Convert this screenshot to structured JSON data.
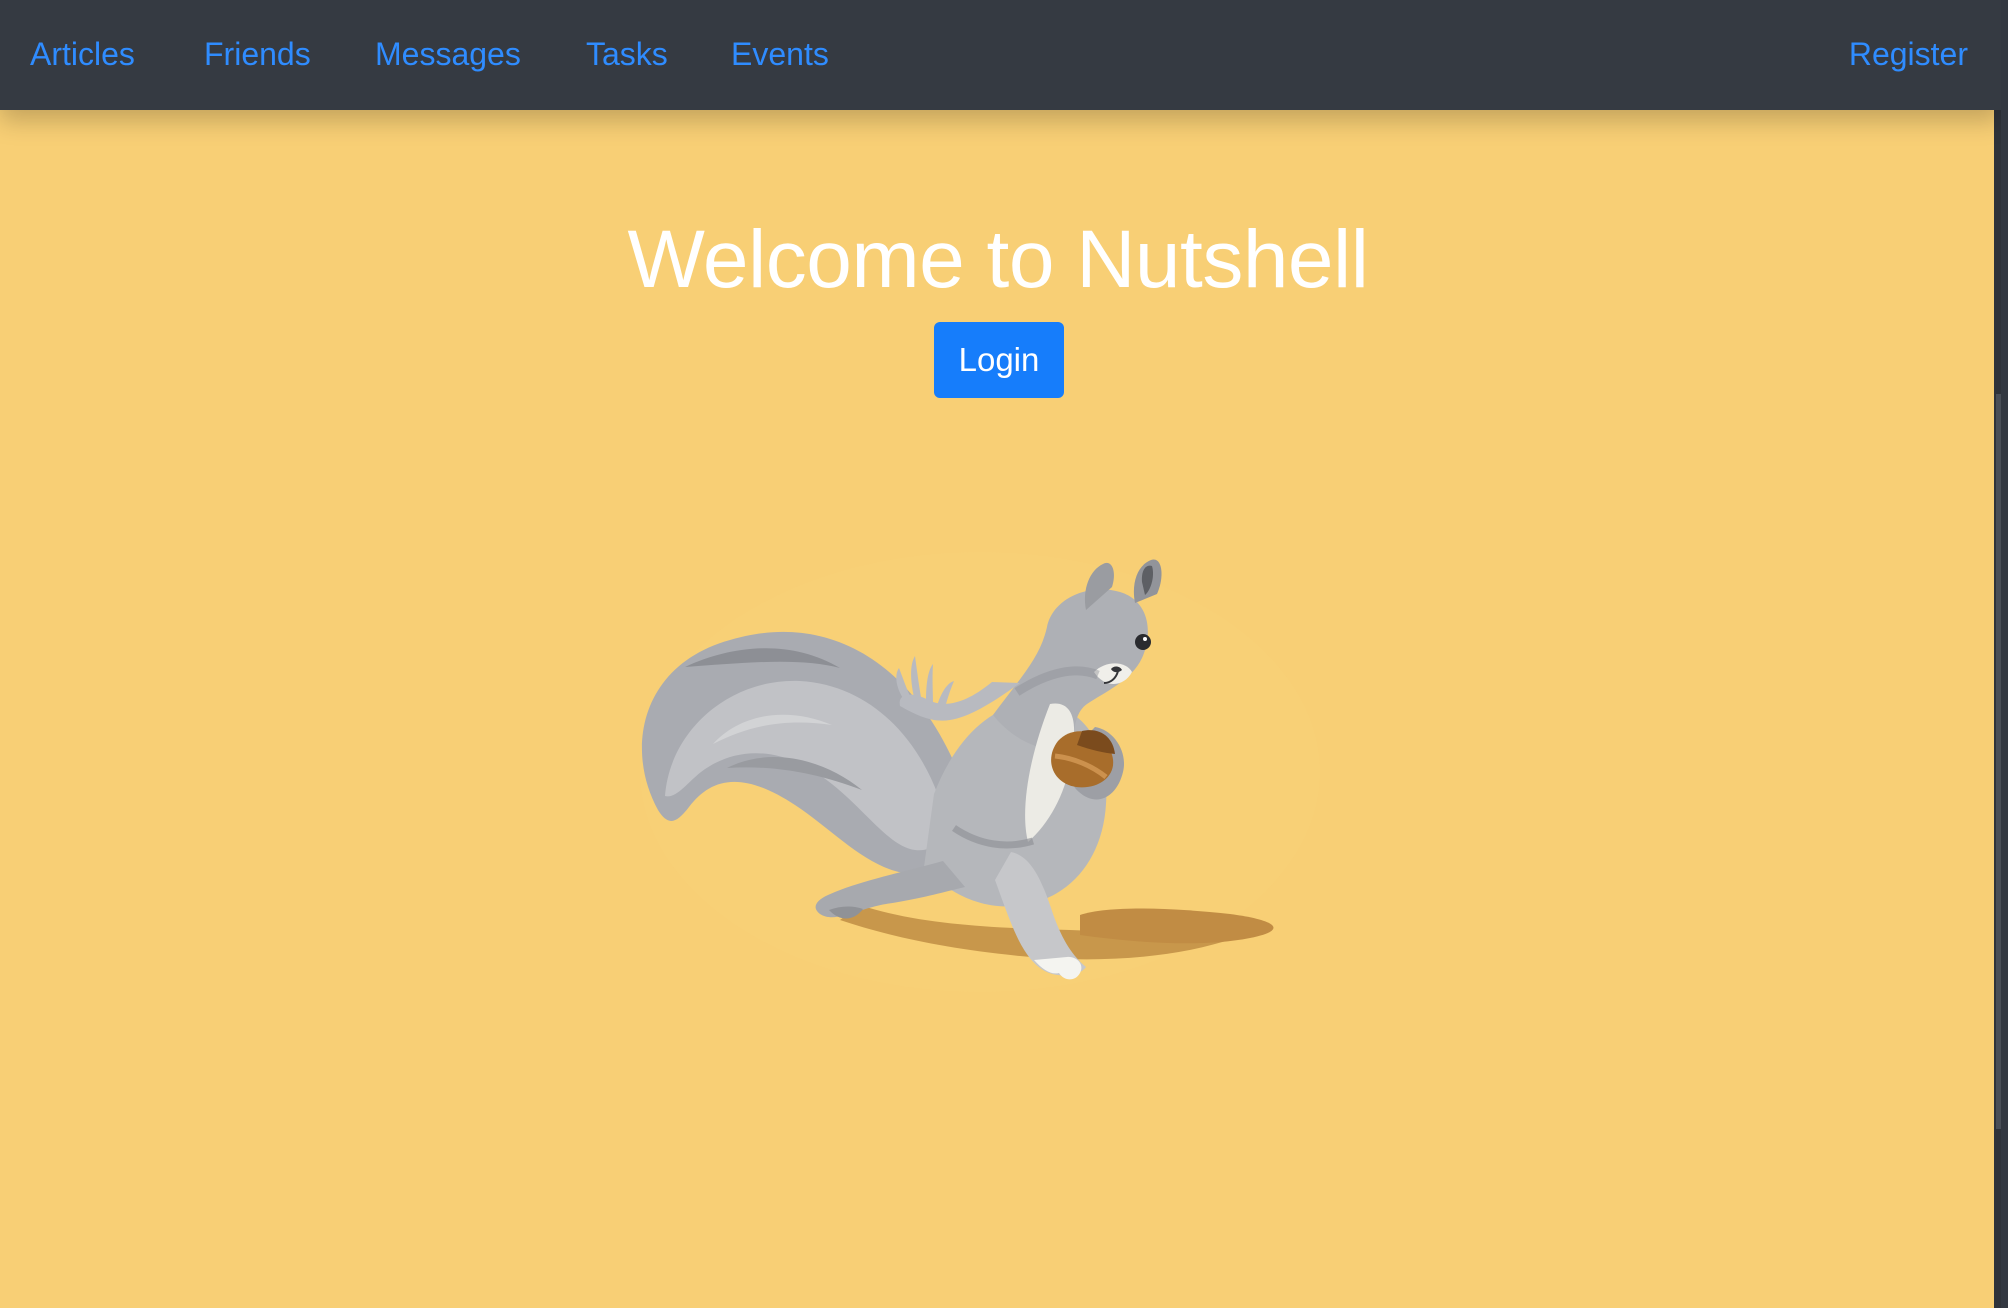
{
  "colors": {
    "background": "#f8cf75",
    "navbar": "#353a42",
    "nav_link": "#2f8cff",
    "primary_button": "#167dfb",
    "title_text": "#ffffff"
  },
  "navbar": {
    "items": [
      {
        "label": "Articles"
      },
      {
        "label": "Friends"
      },
      {
        "label": "Messages"
      },
      {
        "label": "Tasks"
      },
      {
        "label": "Events"
      }
    ],
    "register_label": "Register"
  },
  "hero": {
    "title": "Welcome to Nutshell",
    "login_label": "Login",
    "illustration": "squirrel-with-acorn"
  }
}
